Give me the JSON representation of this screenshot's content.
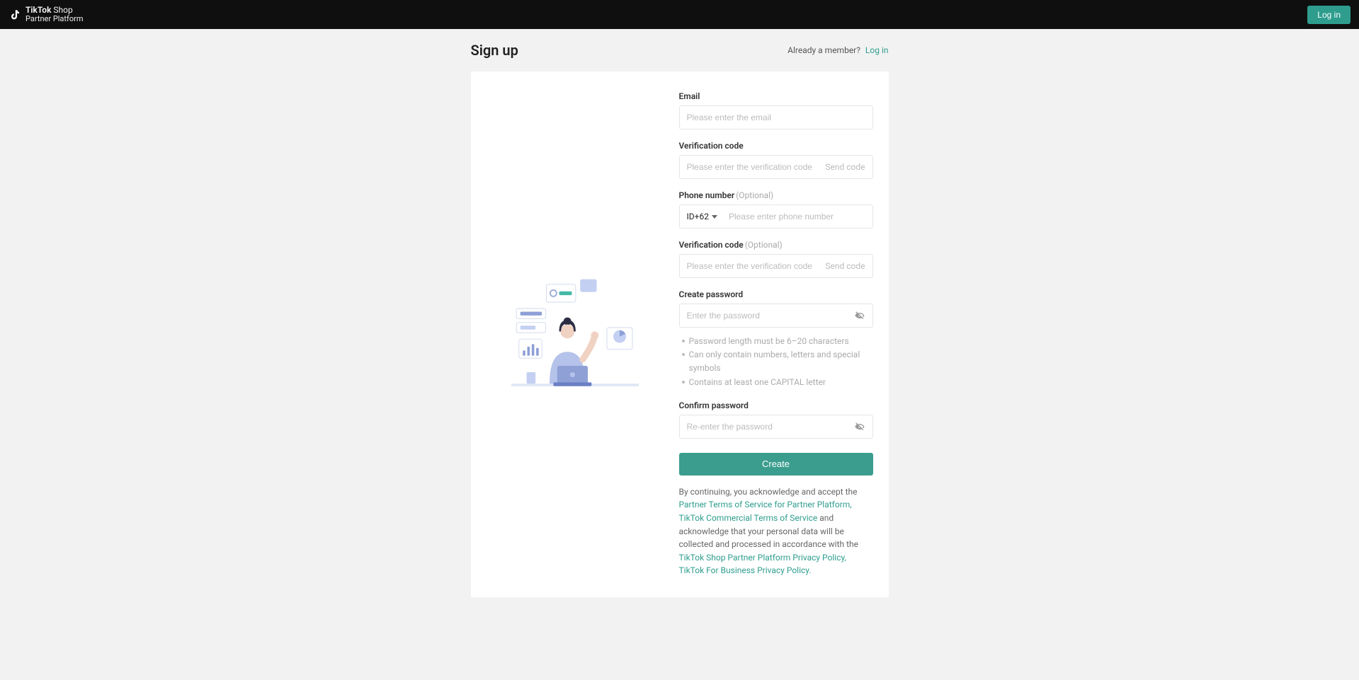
{
  "header": {
    "brand_tiktok": "TikTok",
    "brand_shop": "Shop",
    "brand_sub": "Partner Platform",
    "login_button": "Log in"
  },
  "page": {
    "title": "Sign up",
    "already_text": "Already a member?",
    "login_link": "Log in"
  },
  "form": {
    "email": {
      "label": "Email",
      "placeholder": "Please enter the email"
    },
    "verify_email": {
      "label": "Verification code",
      "placeholder": "Please enter the verification code",
      "send": "Send code"
    },
    "phone": {
      "label": "Phone number",
      "optional": "(Optional)",
      "country": "ID+62",
      "placeholder": "Please enter phone number"
    },
    "verify_phone": {
      "label": "Verification code",
      "optional": "(Optional)",
      "placeholder": "Please enter the verification code",
      "send": "Send code"
    },
    "password": {
      "label": "Create password",
      "placeholder": "Enter the password",
      "hints": [
        "Password length must be 6–20 characters",
        "Can only contain numbers, letters and special symbols",
        "Contains at least one CAPITAL letter"
      ]
    },
    "confirm": {
      "label": "Confirm password",
      "placeholder": "Re-enter the password"
    },
    "submit": "Create"
  },
  "legal": {
    "prefix": "By continuing, you acknowledge and accept the ",
    "link1": "Partner Terms of Service for Partner Platform, TikTok Commercial Terms of Service",
    "middle": "and acknowledge that your personal data will be collected and processed in accordance with the ",
    "link2": "TikTok Shop Partner Platform Privacy Policy, TikTok For Business Privacy Policy."
  },
  "colors": {
    "accent": "#2e9d8e"
  }
}
